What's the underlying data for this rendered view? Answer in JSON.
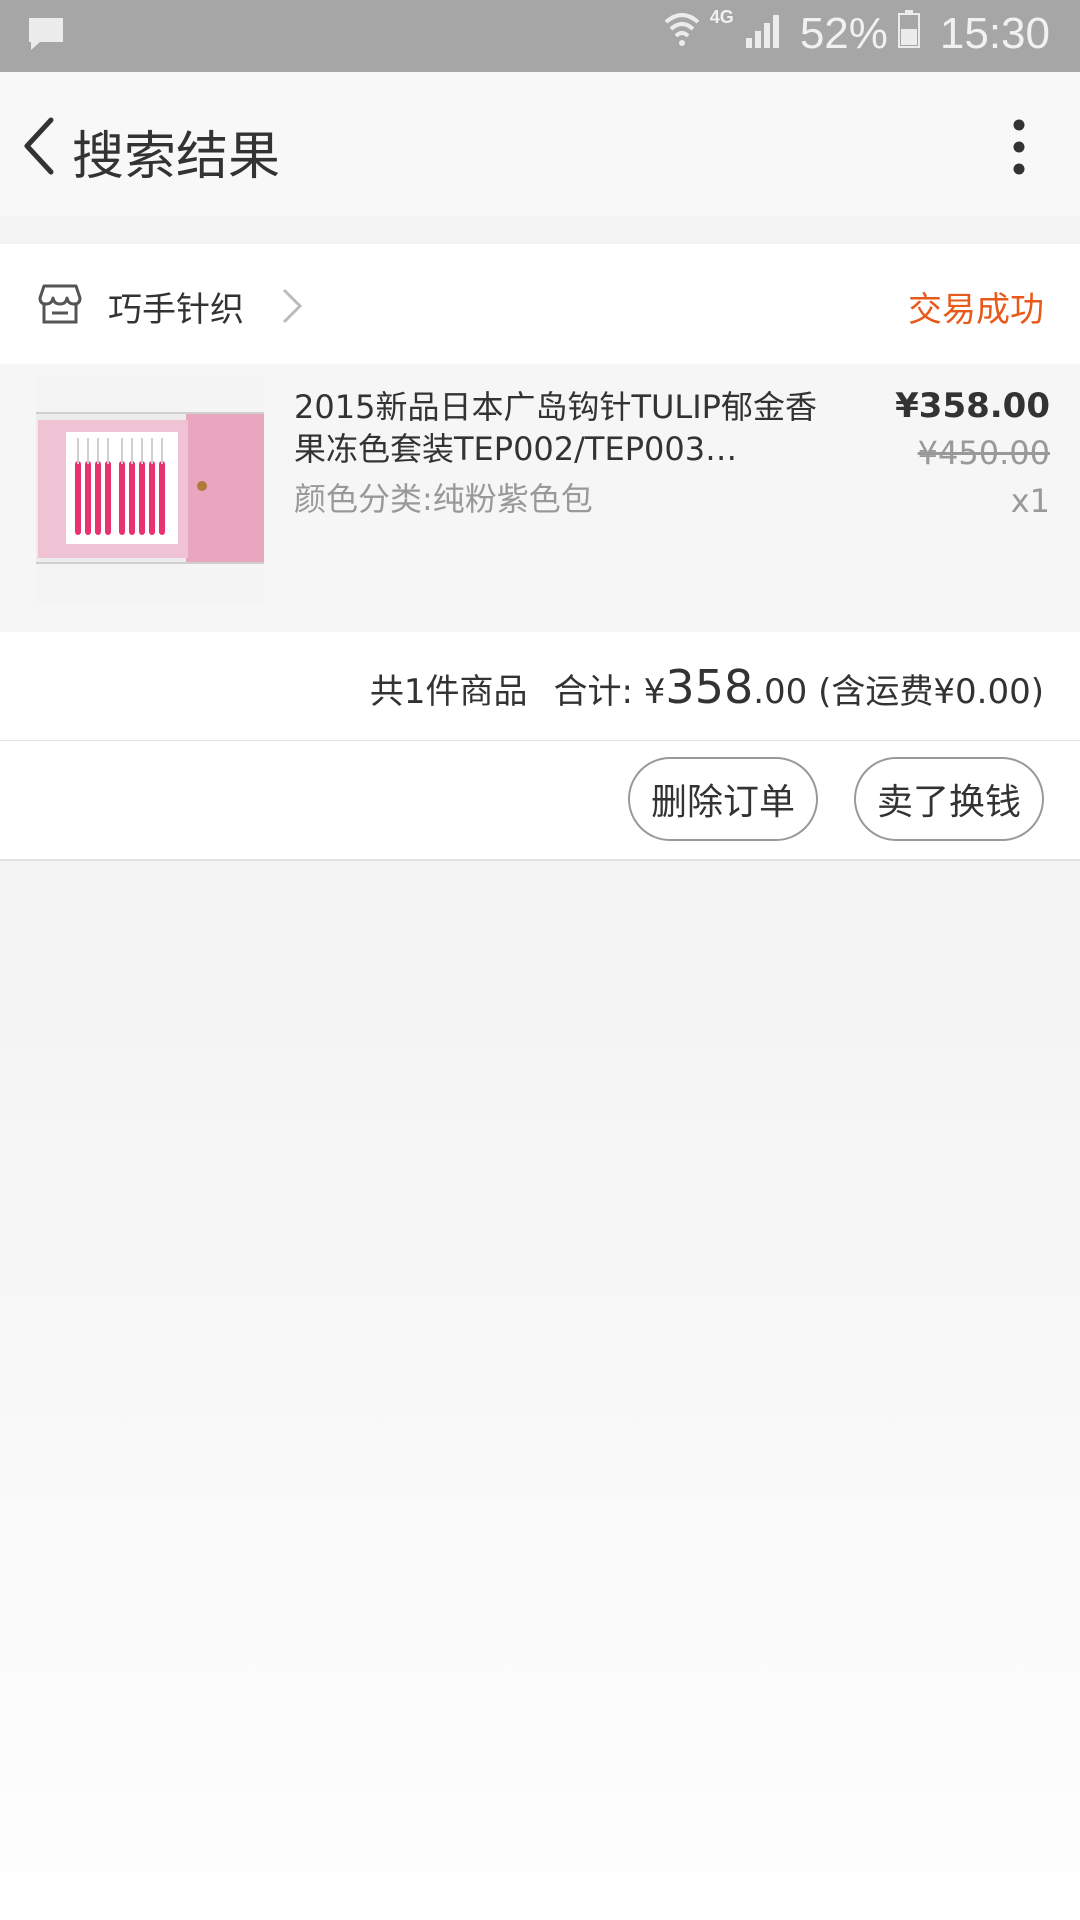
{
  "status_bar": {
    "network": "4G",
    "battery": "52%",
    "time": "15:30",
    "icons": [
      "chat-icon",
      "wifi-icon",
      "signal-icon",
      "battery-icon"
    ]
  },
  "header": {
    "title": "搜索结果",
    "icons": [
      "back-arrow-icon",
      "more-vertical-icon"
    ]
  },
  "order": {
    "shop_name": "巧手针织",
    "status": "交易成功",
    "product": {
      "title": "2015新品日本广岛钩针TULIP郁金香果冻色套装TEP002/TEP003…",
      "sku": "颜色分类:纯粉紫色包",
      "price": "¥358.00",
      "original_price": "¥450.00",
      "quantity": "x1"
    },
    "summary": {
      "count_text": "共1件商品",
      "total_label": "合计: ¥",
      "total_main": "358",
      "total_decimal": ".00",
      "shipping": "(含运费¥0.00)"
    },
    "actions": {
      "delete": "删除订单",
      "sell": "卖了换钱"
    }
  },
  "colors": {
    "status_bar": "#a6a6a6",
    "accent": "#e85a1b",
    "background": "#f3f3f3"
  }
}
